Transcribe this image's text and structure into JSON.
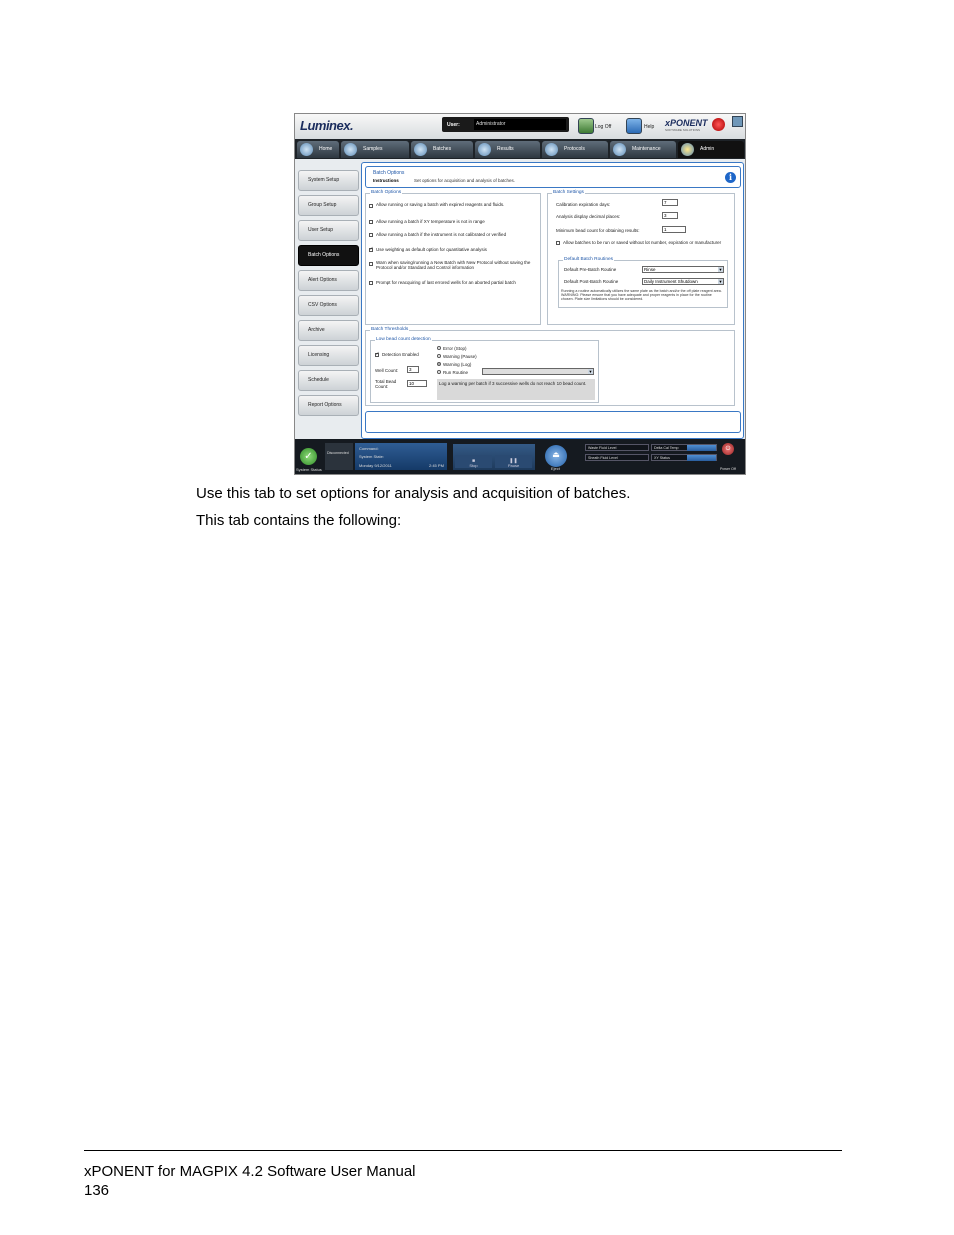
{
  "app": {
    "logo": "Luminex.",
    "user_label": "User:",
    "user_value": "Administrator",
    "logoff": "Log Off",
    "help": "Help",
    "product": "xPONENT",
    "product_sub": "SOFTWARE SOLUTIONS",
    "tabs": [
      {
        "label": "Home"
      },
      {
        "label": "Samples"
      },
      {
        "label": "Batches"
      },
      {
        "label": "Results"
      },
      {
        "label": "Protocols"
      },
      {
        "label": "Maintenance"
      },
      {
        "label": "Admin"
      }
    ],
    "sidebar": [
      {
        "label": "System Setup"
      },
      {
        "label": "Group Setup"
      },
      {
        "label": "User Setup"
      },
      {
        "label": "Batch Options"
      },
      {
        "label": "Alert Options"
      },
      {
        "label": "CSV Options"
      },
      {
        "label": "Archive"
      },
      {
        "label": "Licensing"
      },
      {
        "label": "Schedule"
      },
      {
        "label": "Report Options"
      }
    ],
    "title": "Batch Options",
    "instructions_label": "Instructions",
    "instructions_text": "Set options for acquisition and analysis of batches.",
    "batch_options": {
      "legend": "Batch Options",
      "items": [
        {
          "label": "Allow running or saving a batch with expired reagents and fluids.",
          "checked": false
        },
        {
          "label": "Allow running a batch if XY temperature is not in range",
          "checked": false
        },
        {
          "label": "Allow running a batch if the instrument is not calibrated or verified",
          "checked": false
        },
        {
          "label": "Use weighting as default option for quantitative analysis",
          "checked": true
        },
        {
          "label": "Warn when saving/running a New Batch with New Protocol without saving the Protocol and/or Standard and Control information",
          "checked": false
        },
        {
          "label": "Prompt for reacquiring of last errored wells for an aborted partial batch",
          "checked": false
        }
      ]
    },
    "batch_settings": {
      "legend": "Batch Settings",
      "cal_label": "Calibration expiration days:",
      "cal_value": "7",
      "decimal_label": "Analysis display decimal places:",
      "decimal_value": "3",
      "bead_label": "Minimum bead count for obtaining results:",
      "bead_value": "1",
      "allow_label": "Allow batches to be run or saved without lot number, expiration or manufacturer",
      "routines_legend": "Default Batch Routines",
      "pre_label": "Default Pre-Batch Routine",
      "pre_value": "Rinse",
      "post_label": "Default Post-Batch Routine",
      "post_value": "Daily Instrument Shutdown",
      "note": "Running a routine automatically utilizes the same plate as the batch and/or the off plate reagent area. WARNING: Please ensure that you have adequate and proper reagents in place for the routine chosen. Plate size limitations should be considered."
    },
    "thresholds": {
      "legend": "Batch Thresholds",
      "sub_legend": "Low bead count detection",
      "detection_label": "Detection Enabled",
      "well_label": "Well Count:",
      "well_value": "3",
      "total_label": "Total Bead Count:",
      "total_value": "10",
      "radios": [
        {
          "label": "Error (Stop)",
          "on": false
        },
        {
          "label": "Warning (Pause)",
          "on": false
        },
        {
          "label": "Warning (Log)",
          "on": true
        },
        {
          "label": "Run Routine",
          "on": false
        }
      ],
      "log_text": "Log a warning per batch if 3 successive wells do not reach 10 bead count."
    },
    "status": {
      "system_status": "System Status",
      "disconnected": "Disconnected",
      "command": "Command:",
      "system_state": "System State:",
      "datetime_date": "Monday 9/12/2011",
      "datetime_time": "2:45 PM",
      "stop": "Stop",
      "pause": "Pause",
      "eject": "Eject",
      "waste_fluid": "Waste Fluid Level",
      "sheath_fluid": "Sheath Fluid Level",
      "delta_cal": "Delta Cal Temp",
      "xy_status": "XY Status",
      "power": "Power Off"
    }
  },
  "doc": {
    "para1": "Use this tab to set options for analysis and acquisition of batches.",
    "para2": "This tab contains the following:",
    "footer_title": "xPONENT for MAGPIX 4.2 Software User Manual",
    "footer_page": "136"
  }
}
